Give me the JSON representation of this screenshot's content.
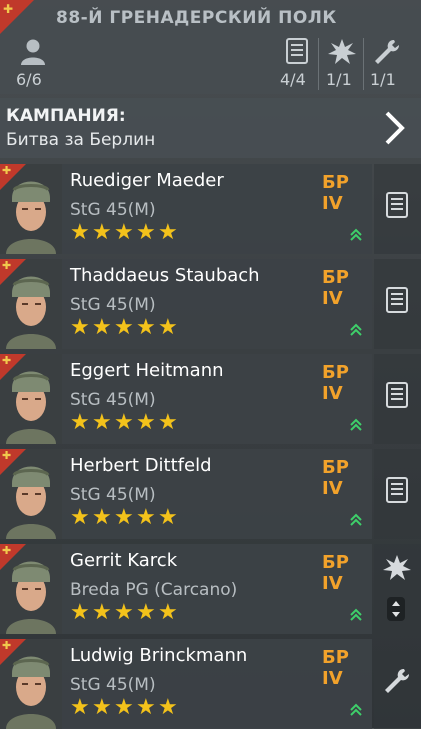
{
  "header": {
    "regiment": "88-Й ГРЕНАДЕРСКИЙ ПОЛК",
    "soldiers_count": "6/6",
    "stat1": "4/4",
    "stat2": "1/1",
    "stat3": "1/1"
  },
  "campaign": {
    "label": "КАМПАНИЯ:",
    "value": "Битва за Берлин"
  },
  "soldiers": [
    {
      "name": "Ruediger Maeder",
      "weapon": "StG 45(M)",
      "rank": "БР IV",
      "stars": 5,
      "side_icon": "equipment-list-icon"
    },
    {
      "name": "Thaddaeus Staubach",
      "weapon": "StG 45(M)",
      "rank": "БР IV",
      "stars": 5,
      "side_icon": "equipment-list-icon"
    },
    {
      "name": "Eggert Heitmann",
      "weapon": "StG 45(M)",
      "rank": "БР IV",
      "stars": 5,
      "side_icon": "equipment-list-icon"
    },
    {
      "name": "Herbert Dittfeld",
      "weapon": "StG 45(M)",
      "rank": "БР IV",
      "stars": 5,
      "side_icon": "equipment-list-icon"
    },
    {
      "name": "Gerrit Karck",
      "weapon": "Breda PG (Carcano)",
      "rank": "БР IV",
      "stars": 5,
      "side_icon": "explosion-icon"
    },
    {
      "name": "Ludwig Brinckmann",
      "weapon": "StG 45(M)",
      "rank": "БР IV",
      "stars": 5,
      "side_icon": "wrench-icon"
    }
  ]
}
